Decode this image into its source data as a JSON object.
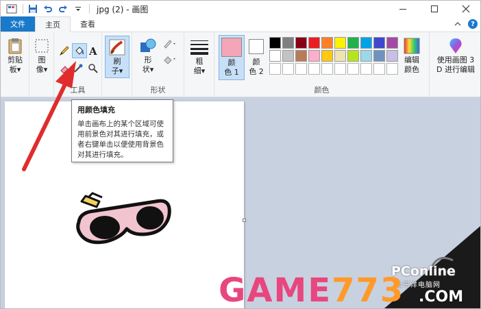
{
  "window": {
    "title": "jpg (2) - 画图",
    "controls": [
      "minimize",
      "maximize",
      "close"
    ]
  },
  "tabs": [
    {
      "label": "文件"
    },
    {
      "label": "主页"
    },
    {
      "label": "查看"
    }
  ],
  "ribbon": {
    "clipboard": {
      "paste_label": "剪贴\n板▾"
    },
    "image": {
      "image_label": "图\n像▾"
    },
    "tools": {
      "group_label": "工具"
    },
    "brushes": {
      "label": "刷\n子▾"
    },
    "shapes": {
      "shapes_label": "形\n状▾",
      "group_label": "形状"
    },
    "size": {
      "label": "粗\n细▾"
    },
    "colors": {
      "color1_label": "颜\n色 1",
      "color2_label": "颜\n色 2",
      "edit_label": "编辑\n颜色",
      "group_label": "颜色",
      "color1_value": "#f4a6b8",
      "color2_value": "#ffffff",
      "palette_row1": [
        "#000000",
        "#7f7f7f",
        "#880015",
        "#ed1c24",
        "#ff7f27",
        "#fff200",
        "#22b14c",
        "#00a2e8",
        "#3f48cc",
        "#a349a4"
      ],
      "palette_row2": [
        "#ffffff",
        "#c3c3c3",
        "#b97a57",
        "#ffaec9",
        "#ffc90e",
        "#efe4b0",
        "#b5e61d",
        "#99d9ea",
        "#7092be",
        "#c8bfe7"
      ]
    },
    "paint3d": {
      "label": "使用画图 3\nD 进行编辑"
    }
  },
  "tooltip": {
    "title": "用颜色填充",
    "body": "单击画布上的某个区域可使用前景色对其进行填充，或者右键单击以便使用背景色对其进行填充。"
  },
  "watermark": {
    "pc": "PConline",
    "cn": "太平洋电脑网",
    "game_a": "GAME",
    "game_b": "773",
    "game_c": ".COM"
  }
}
